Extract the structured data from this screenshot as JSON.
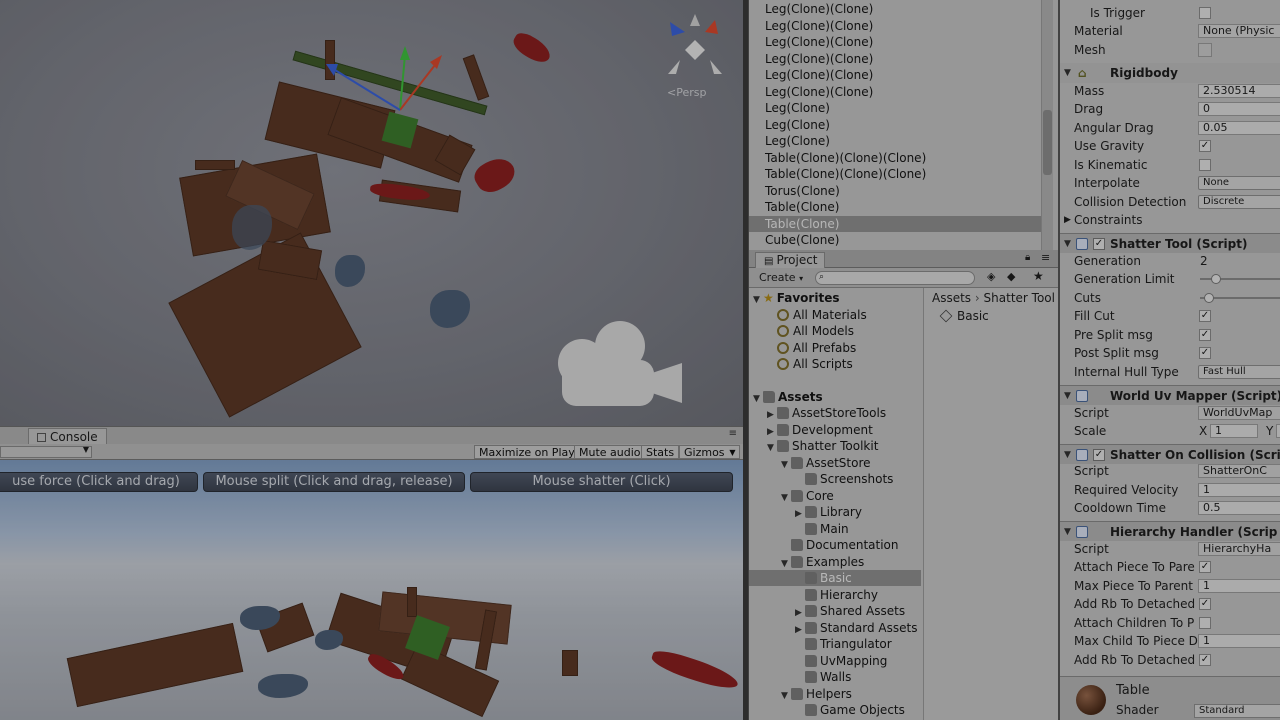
{
  "scene": {
    "projection_label": "<Persp"
  },
  "console": {
    "tab_label": "Console"
  },
  "game_toolbar": {
    "maximize_on_play": "Maximize on Play",
    "mute_audio": "Mute audio",
    "stats": "Stats",
    "gizmos": "Gizmos"
  },
  "game": {
    "buttons": [
      "use force (Click and drag)",
      "Mouse split (Click and drag, release)",
      "Mouse shatter (Click)"
    ]
  },
  "hierarchy": {
    "items": [
      "Leg(Clone)(Clone)",
      "Leg(Clone)(Clone)",
      "Leg(Clone)(Clone)",
      "Leg(Clone)(Clone)",
      "Leg(Clone)(Clone)",
      "Leg(Clone)(Clone)",
      "Leg(Clone)",
      "Leg(Clone)",
      "Leg(Clone)",
      "Table(Clone)(Clone)(Clone)",
      "Table(Clone)(Clone)(Clone)",
      "Torus(Clone)",
      "Table(Clone)",
      "Table(Clone)",
      "Cube(Clone)"
    ],
    "selected_index": 13
  },
  "project": {
    "tab_label": "Project",
    "create_label": "Create",
    "favorites_label": "Favorites",
    "favorites": [
      "All Materials",
      "All Models",
      "All Prefabs",
      "All Scripts"
    ],
    "assets_label": "Assets",
    "tree": [
      {
        "label": "AssetStoreTools",
        "depth": 1
      },
      {
        "label": "Development",
        "depth": 1
      },
      {
        "label": "Shatter Toolkit",
        "depth": 1
      },
      {
        "label": "AssetStore",
        "depth": 2
      },
      {
        "label": "Screenshots",
        "depth": 3
      },
      {
        "label": "Core",
        "depth": 2
      },
      {
        "label": "Library",
        "depth": 3
      },
      {
        "label": "Main",
        "depth": 3
      },
      {
        "label": "Documentation",
        "depth": 2
      },
      {
        "label": "Examples",
        "depth": 2
      },
      {
        "label": "Basic",
        "depth": 3
      },
      {
        "label": "Hierarchy",
        "depth": 3
      },
      {
        "label": "Shared Assets",
        "depth": 3
      },
      {
        "label": "Standard Assets",
        "depth": 3
      },
      {
        "label": "Triangulator",
        "depth": 3
      },
      {
        "label": "UvMapping",
        "depth": 3
      },
      {
        "label": "Walls",
        "depth": 3
      },
      {
        "label": "Helpers",
        "depth": 2
      },
      {
        "label": "Game Objects",
        "depth": 3
      }
    ],
    "selected_tree_index": 10,
    "breadcrumb": [
      "Assets",
      "Shatter Tool"
    ],
    "breadcrumb_sep": "›",
    "contents": [
      "Basic"
    ]
  },
  "inspector": {
    "collider": {
      "is_trigger_label": "Is Trigger",
      "material_label": "Material",
      "material_value": "None (Physic",
      "mesh_label": "Mesh"
    },
    "rigidbody": {
      "title": "Rigidbody",
      "mass_label": "Mass",
      "mass": "2.530514",
      "drag_label": "Drag",
      "drag": "0",
      "angular_drag_label": "Angular Drag",
      "angular_drag": "0.05",
      "use_gravity_label": "Use Gravity",
      "is_kinematic_label": "Is Kinematic",
      "interpolate_label": "Interpolate",
      "interpolate": "None",
      "collision_label": "Collision Detection",
      "collision": "Discrete",
      "constraints_label": "Constraints"
    },
    "shatter_tool": {
      "title": "Shatter Tool (Script)",
      "generation_label": "Generation",
      "generation": "2",
      "generation_limit_label": "Generation Limit",
      "generation_limit_level": 0.18,
      "cuts_label": "Cuts",
      "cuts_level": 0.1,
      "fill_cut_label": "Fill Cut",
      "pre_split_label": "Pre Split msg",
      "post_split_label": "Post Split msg",
      "hull_label": "Internal Hull Type",
      "hull": "Fast Hull"
    },
    "world_uv": {
      "title": "World Uv Mapper (Script)",
      "script_label": "Script",
      "script": "WorldUvMap",
      "scale_label": "Scale",
      "scale_x_label": "X",
      "scale_x": "1",
      "scale_y_label": "Y"
    },
    "shatter_collision": {
      "title": "Shatter On Collision (Scrip",
      "script_label": "Script",
      "script": "ShatterOnC",
      "required_velocity_label": "Required Velocity",
      "required_velocity": "1",
      "cooldown_label": "Cooldown Time",
      "cooldown": "0.5"
    },
    "hierarchy_handler": {
      "title": "Hierarchy Handler (Scrip",
      "script_label": "Script",
      "script": "HierarchyHa",
      "attach_piece_label": "Attach Piece To Pare",
      "max_piece_label": "Max Piece To Parent",
      "max_piece": "1",
      "add_rb_label": "Add Rb To Detached",
      "attach_children_label": "Attach Children To P",
      "max_child_label": "Max Child To Piece D",
      "max_child": "1",
      "add_rb2_label": "Add Rb To Detached"
    },
    "material": {
      "name": "Table",
      "shader_label": "Shader",
      "shader": "Standard"
    }
  }
}
